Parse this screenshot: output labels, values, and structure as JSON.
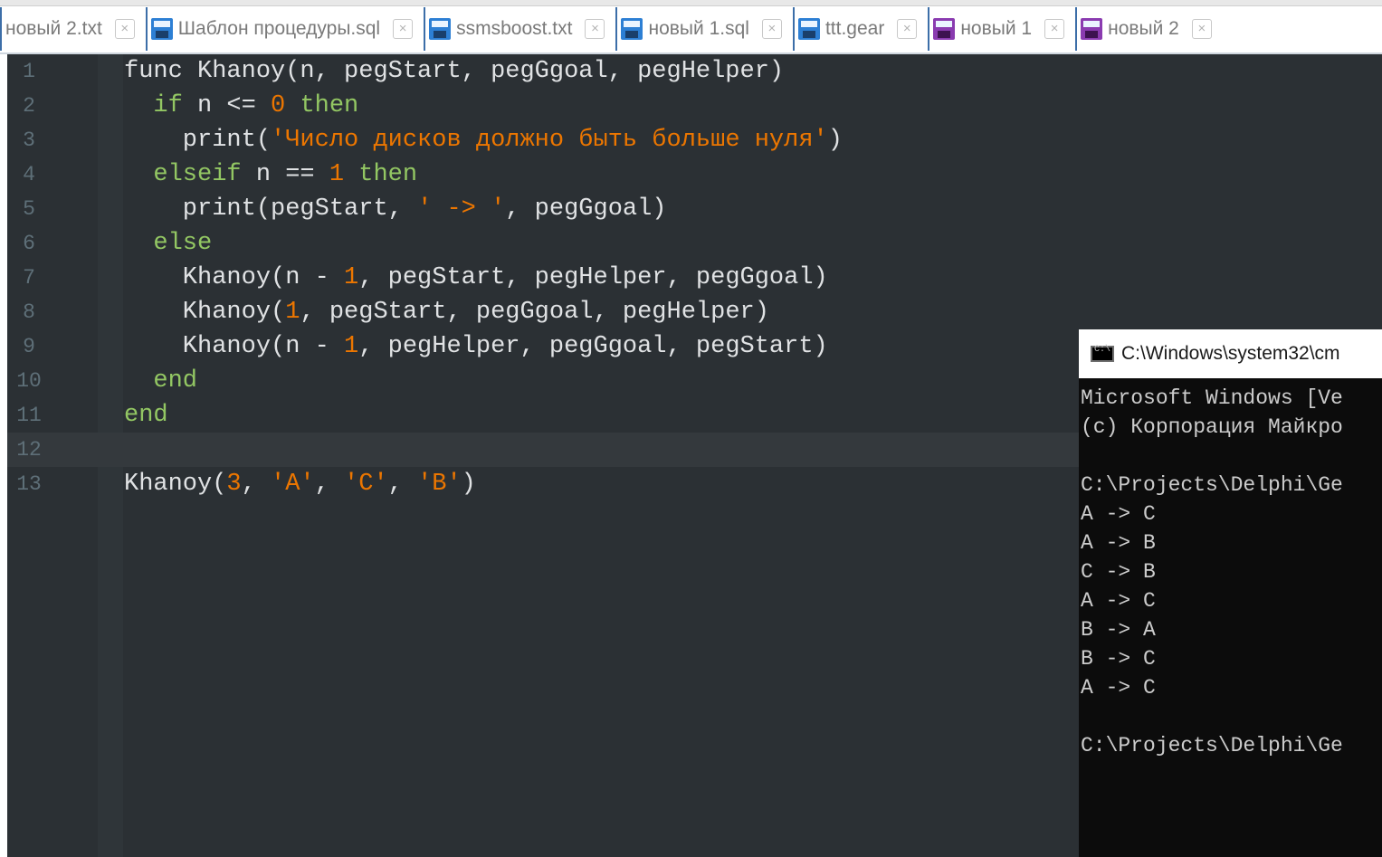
{
  "tabs": [
    {
      "label": "новый 2.txt",
      "icon": "none",
      "close": "×"
    },
    {
      "label": "Шаблон процедуры.sql",
      "icon": "floppy-blue",
      "close": "×"
    },
    {
      "label": "ssmsboost.txt",
      "icon": "floppy-blue",
      "close": "×"
    },
    {
      "label": "новый 1.sql",
      "icon": "floppy-blue",
      "close": "×"
    },
    {
      "label": "ttt.gear",
      "icon": "floppy-blue",
      "close": "×"
    },
    {
      "label": "новый 1",
      "icon": "floppy-purple",
      "close": "×"
    },
    {
      "label": "новый 2",
      "icon": "floppy-purple",
      "close": "×"
    }
  ],
  "editor": {
    "current_line": 12,
    "colors": {
      "background": "#2b3034",
      "keyword": "#93c763",
      "string": "#ec7600",
      "number": "#ec7600",
      "text": "#e0e2e4",
      "line_number": "#5e6f78"
    },
    "lines": [
      {
        "num": "1",
        "tokens": [
          {
            "t": "    func Khanoy(n, pegStart, pegGgoal, pegHelper)",
            "c": "plain"
          }
        ]
      },
      {
        "num": "2",
        "tokens": [
          {
            "t": "      ",
            "c": "plain"
          },
          {
            "t": "if",
            "c": "kw"
          },
          {
            "t": " n <= ",
            "c": "plain"
          },
          {
            "t": "0",
            "c": "num"
          },
          {
            "t": " ",
            "c": "plain"
          },
          {
            "t": "then",
            "c": "kw"
          }
        ]
      },
      {
        "num": "3",
        "tokens": [
          {
            "t": "        print(",
            "c": "plain"
          },
          {
            "t": "'Число дисков должно быть больше нуля'",
            "c": "str"
          },
          {
            "t": ")",
            "c": "plain"
          }
        ]
      },
      {
        "num": "4",
        "tokens": [
          {
            "t": "      ",
            "c": "plain"
          },
          {
            "t": "elseif",
            "c": "kw"
          },
          {
            "t": " n == ",
            "c": "plain"
          },
          {
            "t": "1",
            "c": "num"
          },
          {
            "t": " ",
            "c": "plain"
          },
          {
            "t": "then",
            "c": "kw"
          }
        ]
      },
      {
        "num": "5",
        "tokens": [
          {
            "t": "        print(pegStart, ",
            "c": "plain"
          },
          {
            "t": "' -> '",
            "c": "str"
          },
          {
            "t": ", pegGgoal)",
            "c": "plain"
          }
        ]
      },
      {
        "num": "6",
        "tokens": [
          {
            "t": "      ",
            "c": "plain"
          },
          {
            "t": "else",
            "c": "kw"
          }
        ]
      },
      {
        "num": "7",
        "tokens": [
          {
            "t": "        Khanoy(n - ",
            "c": "plain"
          },
          {
            "t": "1",
            "c": "num"
          },
          {
            "t": ", pegStart, pegHelper, pegGgoal)",
            "c": "plain"
          }
        ]
      },
      {
        "num": "8",
        "tokens": [
          {
            "t": "        Khanoy(",
            "c": "plain"
          },
          {
            "t": "1",
            "c": "num"
          },
          {
            "t": ", pegStart, pegGgoal, pegHelper)",
            "c": "plain"
          }
        ]
      },
      {
        "num": "9",
        "tokens": [
          {
            "t": "        Khanoy(n - ",
            "c": "plain"
          },
          {
            "t": "1",
            "c": "num"
          },
          {
            "t": ", pegHelper, pegGgoal, pegStart)",
            "c": "plain"
          }
        ]
      },
      {
        "num": "10",
        "tokens": [
          {
            "t": "      ",
            "c": "plain"
          },
          {
            "t": "end",
            "c": "kw"
          }
        ]
      },
      {
        "num": "11",
        "tokens": [
          {
            "t": "    ",
            "c": "plain"
          },
          {
            "t": "end",
            "c": "kw"
          }
        ]
      },
      {
        "num": "12",
        "tokens": []
      },
      {
        "num": "13",
        "tokens": [
          {
            "t": "    Khanoy(",
            "c": "plain"
          },
          {
            "t": "3",
            "c": "num"
          },
          {
            "t": ", ",
            "c": "plain"
          },
          {
            "t": "'A'",
            "c": "str"
          },
          {
            "t": ", ",
            "c": "plain"
          },
          {
            "t": "'C'",
            "c": "str"
          },
          {
            "t": ", ",
            "c": "plain"
          },
          {
            "t": "'B'",
            "c": "str"
          },
          {
            "t": ")",
            "c": "plain"
          }
        ]
      }
    ]
  },
  "console": {
    "title": "C:\\Windows\\system32\\cm",
    "icon": "cmd-icon",
    "lines": [
      "Microsoft Windows [Ve",
      "(c) Корпорация Майкро",
      "",
      "C:\\Projects\\Delphi\\Ge",
      "A -> C",
      "A -> B",
      "C -> B",
      "A -> C",
      "B -> A",
      "B -> C",
      "A -> C",
      "",
      "C:\\Projects\\Delphi\\Ge"
    ]
  }
}
